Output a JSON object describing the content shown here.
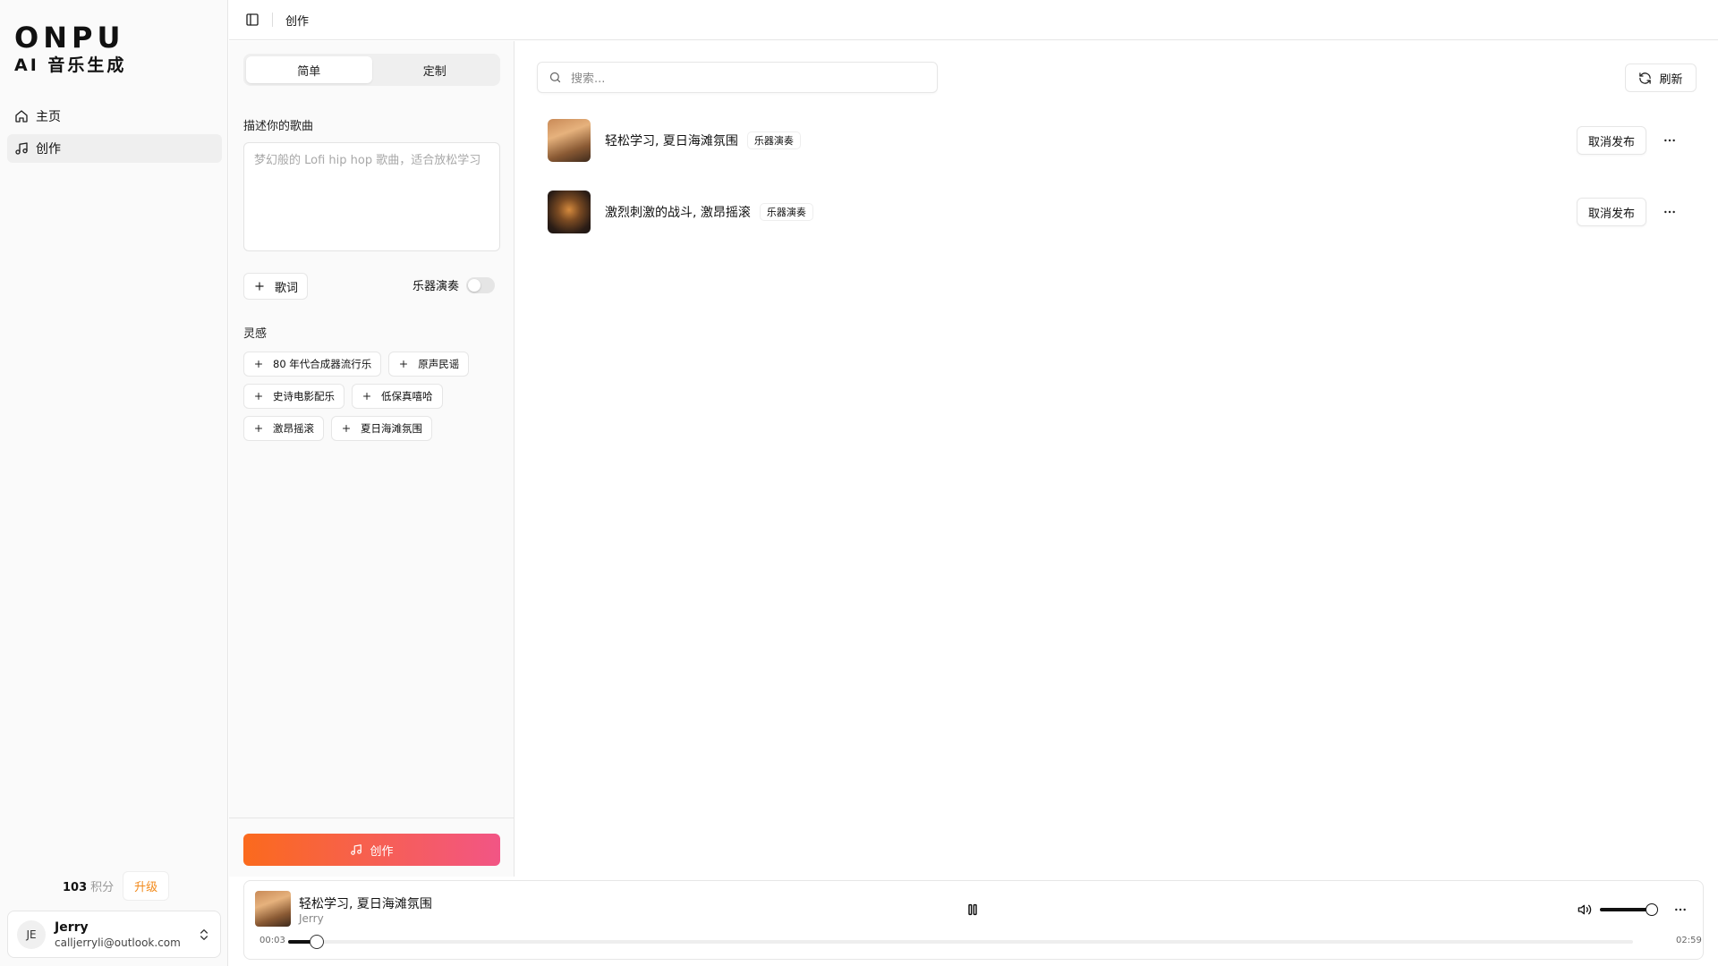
{
  "sidebar": {
    "logo_title": "ONPU",
    "logo_subtitle": "AI 音乐生成",
    "nav": [
      {
        "label": "主页",
        "icon": "home-icon",
        "active": false
      },
      {
        "label": "创作",
        "icon": "music-note-icon",
        "active": true
      }
    ],
    "credits": {
      "value": "103",
      "unit": "积分",
      "upgrade_label": "升级"
    },
    "user": {
      "initials": "JE",
      "name": "Jerry",
      "email": "calljerryli@outlook.com"
    }
  },
  "topbar": {
    "breadcrumb": "创作"
  },
  "create_panel": {
    "tabs": [
      {
        "label": "简单",
        "active": true
      },
      {
        "label": "定制",
        "active": false
      }
    ],
    "describe_label": "描述你的歌曲",
    "describe_placeholder": "梦幻般的 Lofi hip hop 歌曲，适合放松学习",
    "lyrics_label": "歌词",
    "instrumental_label": "乐器演奏",
    "instrumental_on": false,
    "inspiration_label": "灵感",
    "inspirations": [
      [
        "80 年代合成器流行乐",
        "原声民谣"
      ],
      [
        "史诗电影配乐",
        "低保真嘻哈"
      ],
      [
        "激昂摇滚",
        "夏日海滩氛围"
      ]
    ],
    "create_label": "创作"
  },
  "main": {
    "search_placeholder": "搜索...",
    "refresh_label": "刷新",
    "songs": [
      {
        "title": "轻松学习, 夏日海滩氛围",
        "tag": "乐器演奏",
        "action": "取消发布"
      },
      {
        "title": "激烈刺激的战斗, 激昂摇滚",
        "tag": "乐器演奏",
        "action": "取消发布"
      }
    ]
  },
  "player": {
    "title": "轻松学习, 夏日海滩氛围",
    "artist": "Jerry",
    "current_time": "00:03",
    "total_time": "02:59",
    "progress": 0.021,
    "volume": 0.85
  },
  "colors": {
    "accent_start": "#fb6a1d",
    "accent_end": "#f25585",
    "upgrade": "#f28a1b"
  }
}
